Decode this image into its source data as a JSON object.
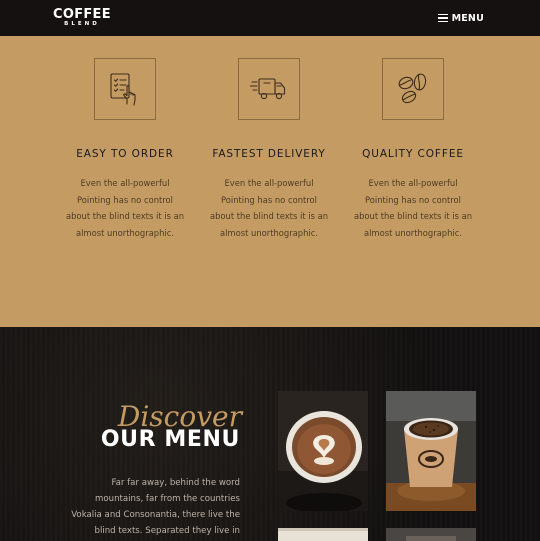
{
  "navbar": {
    "brand_main": "COFFEE",
    "brand_sub": "BLEND",
    "menu_label": "MENU"
  },
  "services": [
    {
      "icon": "order-checklist-icon",
      "title": "EASY TO ORDER",
      "desc": [
        "Even the all-powerful",
        "Pointing has no control",
        "about the blind texts it is an",
        "almost unorthographic."
      ]
    },
    {
      "icon": "delivery-truck-icon",
      "title": "FASTEST DELIVERY",
      "desc": [
        "Even the all-powerful",
        "Pointing has no control",
        "about the blind texts it is an",
        "almost unorthographic."
      ]
    },
    {
      "icon": "coffee-beans-icon",
      "title": "QUALITY COFFEE",
      "desc": [
        "Even the all-powerful",
        "Pointing has no control",
        "about the blind texts it is an",
        "almost unorthographic."
      ]
    }
  ],
  "menu_section": {
    "subheading": "Discover",
    "heading": "OUR MENU",
    "desc": [
      "Far far away, behind the word",
      "mountains, far from the countries",
      "Vokalia and Consonantia, there live the",
      "blind texts. Separated they live in"
    ]
  },
  "colors": {
    "accent": "#c49b63",
    "navbar_bg": "#151111",
    "dark_bg": "#141210"
  }
}
